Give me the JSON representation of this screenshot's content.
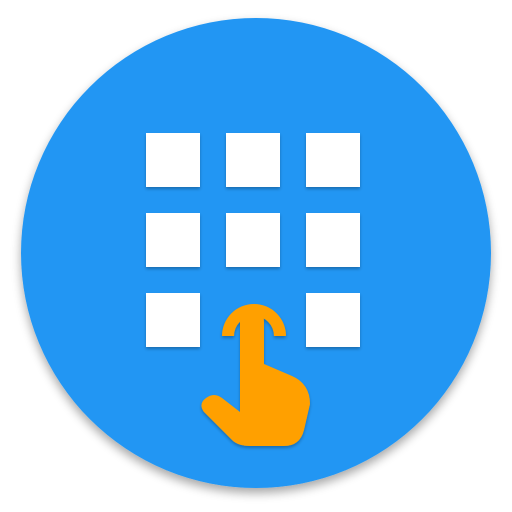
{
  "icon": {
    "name": "keypad-touch-app-icon",
    "colors": {
      "background_circle": "#2196f3",
      "keys": "#ffffff",
      "hand": "#ffa000"
    },
    "grid": {
      "rows": 3,
      "columns": 3
    }
  }
}
